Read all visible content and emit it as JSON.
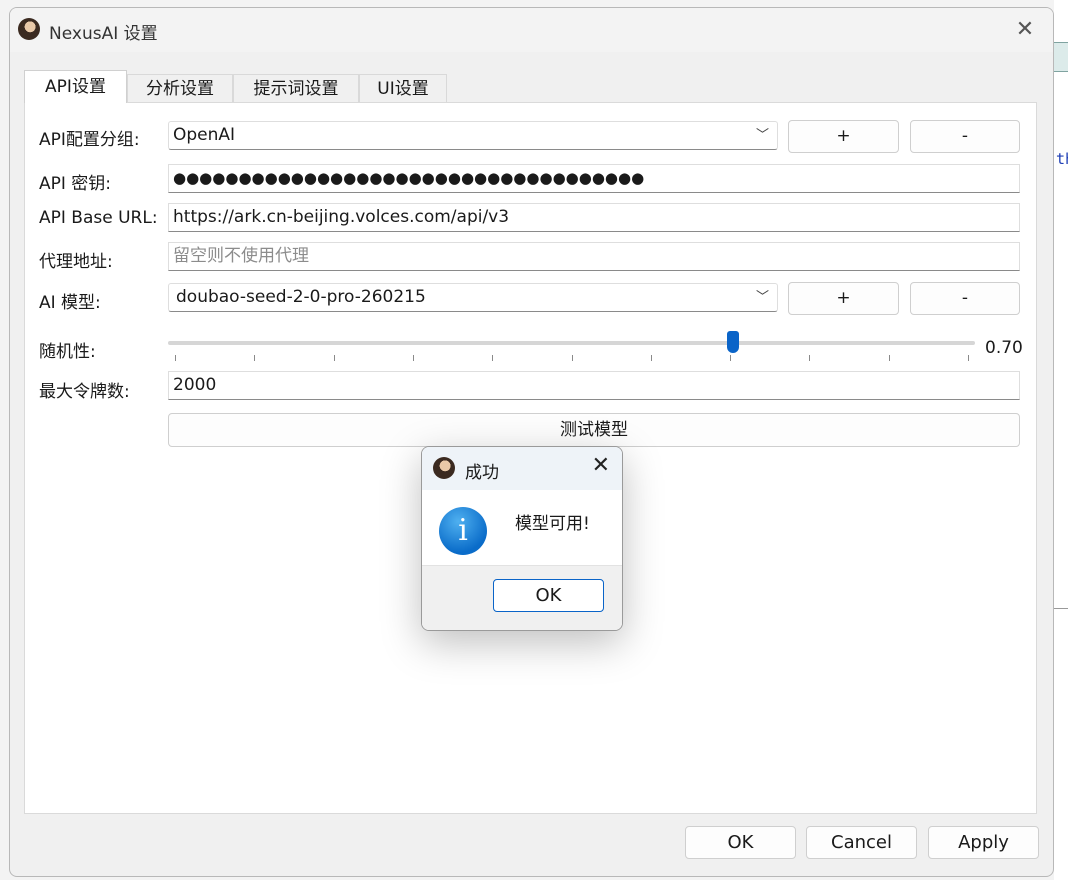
{
  "window": {
    "title": "NexusAI 设置"
  },
  "tabs": [
    {
      "label": "API设置",
      "active": true
    },
    {
      "label": "分析设置",
      "active": false
    },
    {
      "label": "提示词设置",
      "active": false
    },
    {
      "label": "UI设置",
      "active": false
    }
  ],
  "api": {
    "group_label": "API配置分组:",
    "group_value": "OpenAI",
    "add_label": "+",
    "remove_label": "-",
    "key_label": "API 密钥:",
    "key_value": "●●●●●●●●●●●●●●●●●●●●●●●●●●●●●●●●●●●●",
    "base_url_label": "API Base URL:",
    "base_url_value": "https://ark.cn-beijing.volces.com/api/v3",
    "proxy_label": "代理地址:",
    "proxy_placeholder": "留空则不使用代理",
    "model_label": "AI 模型:",
    "model_value": "doubao-seed-2-0-pro-260215",
    "randomness_label": "随机性:",
    "randomness_value": 0.7,
    "randomness_text": "0.70",
    "max_tokens_label": "最大令牌数:",
    "max_tokens_value": "2000",
    "test_button": "测试模型"
  },
  "footer": {
    "ok": "OK",
    "cancel": "Cancel",
    "apply": "Apply"
  },
  "dialog": {
    "title": "成功",
    "message": "模型可用!",
    "ok": "OK"
  },
  "colors": {
    "accent": "#0a64c8",
    "info": "#1780d8"
  }
}
